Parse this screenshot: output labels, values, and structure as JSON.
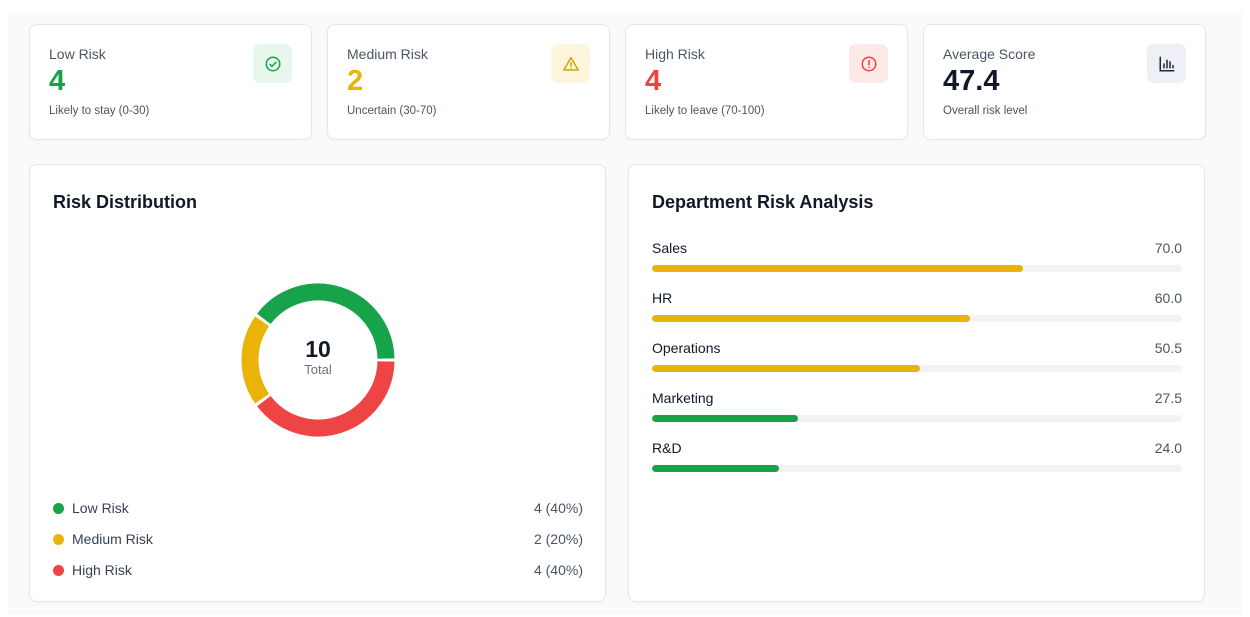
{
  "stats": [
    {
      "title": "Low Risk",
      "value": "4",
      "subtitle": "Likely to stay (0-30)",
      "color": "#16a34a",
      "icon": "check-circle-icon",
      "icon_bg": "#e8f7ec",
      "icon_color": "#16a34a"
    },
    {
      "title": "Medium Risk",
      "value": "2",
      "subtitle": "Uncertain (30-70)",
      "color": "#eab308",
      "icon": "warning-triangle-icon",
      "icon_bg": "#fdf6dc",
      "icon_color": "#d4a20b"
    },
    {
      "title": "High Risk",
      "value": "4",
      "subtitle": "Likely to leave (70-100)",
      "color": "#ef4444",
      "icon": "alert-circle-icon",
      "icon_bg": "#fde8e8",
      "icon_color": "#ef4444"
    },
    {
      "title": "Average Score",
      "value": "47.4",
      "subtitle": "Overall risk level",
      "color": "#111827",
      "icon": "bar-chart-icon",
      "icon_bg": "#eef0f6",
      "icon_color": "#1f2937"
    }
  ],
  "distribution": {
    "title": "Risk Distribution",
    "total": "10",
    "total_label": "Total",
    "segments": [
      {
        "label": "Low Risk",
        "count": 4,
        "display": "4 (40%)",
        "color": "#16a34a"
      },
      {
        "label": "Medium Risk",
        "count": 2,
        "display": "2 (20%)",
        "color": "#eab308"
      },
      {
        "label": "High Risk",
        "count": 4,
        "display": "4 (40%)",
        "color": "#ef4444"
      }
    ]
  },
  "departments": {
    "title": "Department Risk Analysis",
    "max": 100,
    "items": [
      {
        "name": "Sales",
        "score": 70.0,
        "display": "70.0",
        "color": "#eab308"
      },
      {
        "name": "HR",
        "score": 60.0,
        "display": "60.0",
        "color": "#eab308"
      },
      {
        "name": "Operations",
        "score": 50.5,
        "display": "50.5",
        "color": "#eab308"
      },
      {
        "name": "Marketing",
        "score": 27.5,
        "display": "27.5",
        "color": "#16a34a"
      },
      {
        "name": "R&D",
        "score": 24.0,
        "display": "24.0",
        "color": "#16a34a"
      }
    ]
  }
}
